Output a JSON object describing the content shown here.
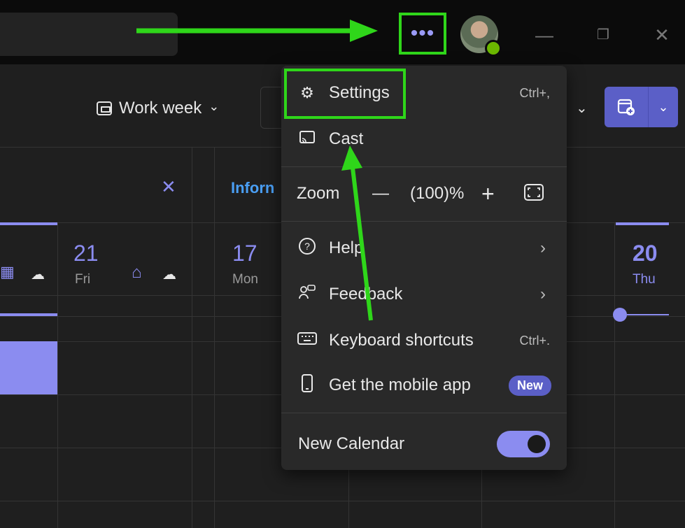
{
  "titlebar": {
    "more_label": "•••",
    "minimize": "—",
    "restore": "❐",
    "close": "✕"
  },
  "toolbar": {
    "view_label": "Work week",
    "view_chevron": "⌄",
    "new_event_icon": "calendar-add-icon",
    "new_event_chevron": "⌄"
  },
  "calendar": {
    "left_day": {
      "num": "21",
      "name": "Fri"
    },
    "mid_day": {
      "num": "17",
      "name": "Mon"
    },
    "right_day": {
      "num": "20",
      "name": "Thu"
    },
    "inform_label": "Inforn",
    "close_x": "✕"
  },
  "menu": {
    "settings": {
      "label": "Settings",
      "shortcut": "Ctrl+,"
    },
    "cast": {
      "label": "Cast"
    },
    "zoom": {
      "label": "Zoom",
      "minus": "—",
      "value": "(100)%",
      "plus": "+"
    },
    "help": {
      "label": "Help"
    },
    "feedback": {
      "label": "Feedback"
    },
    "keyboard": {
      "label": "Keyboard shortcuts",
      "shortcut": "Ctrl+."
    },
    "mobile": {
      "label": "Get the mobile app",
      "badge": "New"
    },
    "new_calendar": {
      "label": "New Calendar",
      "toggle_on": true
    }
  },
  "annotation_color": "#2fd61a",
  "accent": "#5b5fc7"
}
